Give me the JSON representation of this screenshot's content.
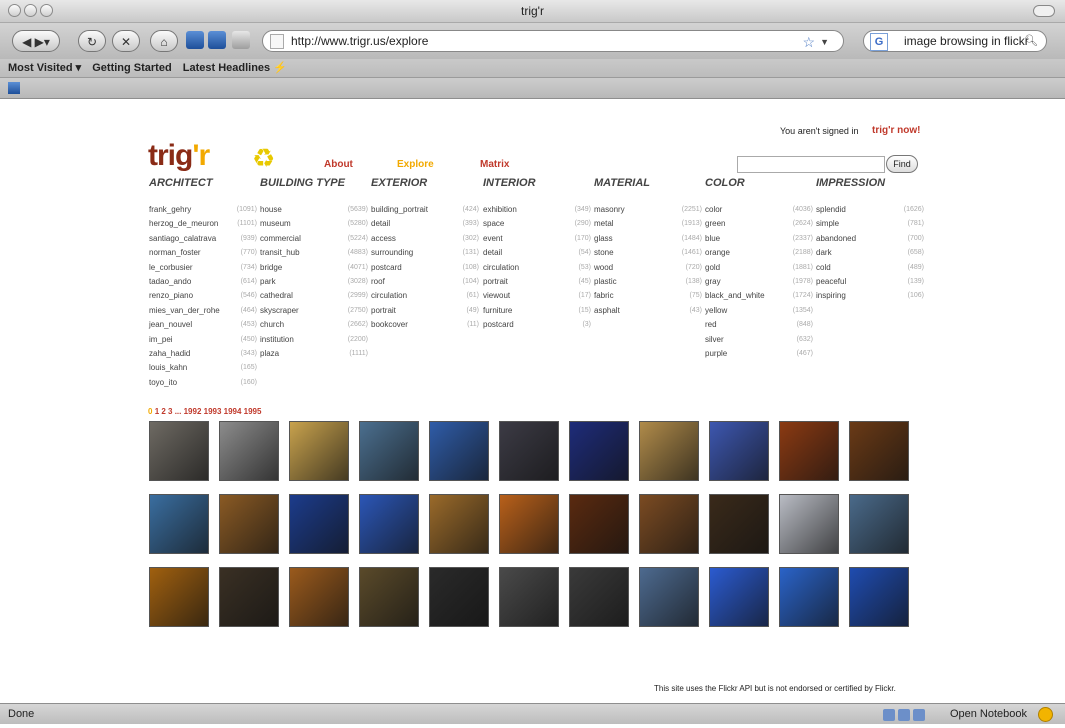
{
  "window": {
    "title": "trig'r"
  },
  "toolbar": {
    "url": "http://www.trigr.us/explore",
    "search_value": "image browsing in flickr",
    "search_engine_glyph": "G"
  },
  "bookmarks": [
    "Most Visited ▾",
    "Getting Started",
    "Latest Headlines ⚡"
  ],
  "statusbar": {
    "left": "Done",
    "right": "Open Notebook"
  },
  "page": {
    "signin_text": "You aren't signed in",
    "trigr_now": "trig'r now!",
    "logo_a": "trig",
    "logo_b": "'r",
    "nav": [
      {
        "label": "About",
        "color": "#c0392b"
      },
      {
        "label": "Explore",
        "color": "#f2a900"
      },
      {
        "label": "Matrix",
        "color": "#c0392b"
      }
    ],
    "find_label": "Find",
    "columns": [
      {
        "title": "ARCHITECT",
        "items": [
          [
            "frank_gehry",
            "(1091)"
          ],
          [
            "herzog_de_meuron",
            "(1101)"
          ],
          [
            "santiago_calatrava",
            "(939)"
          ],
          [
            "norman_foster",
            "(770)"
          ],
          [
            "le_corbusier",
            "(734)"
          ],
          [
            "tadao_ando",
            "(614)"
          ],
          [
            "renzo_piano",
            "(546)"
          ],
          [
            "mies_van_der_rohe",
            "(464)"
          ],
          [
            "jean_nouvel",
            "(453)"
          ],
          [
            "im_pei",
            "(450)"
          ],
          [
            "zaha_hadid",
            "(343)"
          ],
          [
            "louis_kahn",
            "(165)"
          ],
          [
            "toyo_ito",
            "(160)"
          ]
        ]
      },
      {
        "title": "BUILDING TYPE",
        "items": [
          [
            "house",
            "(5639)"
          ],
          [
            "museum",
            "(5280)"
          ],
          [
            "commercial",
            "(5224)"
          ],
          [
            "transit_hub",
            "(4883)"
          ],
          [
            "bridge",
            "(4071)"
          ],
          [
            "park",
            "(3028)"
          ],
          [
            "cathedral",
            "(2999)"
          ],
          [
            "skyscraper",
            "(2750)"
          ],
          [
            "church",
            "(2662)"
          ],
          [
            "institution",
            "(2200)"
          ],
          [
            "plaza",
            "(1111)"
          ]
        ]
      },
      {
        "title": "EXTERIOR",
        "items": [
          [
            "building_portrait",
            "(424)"
          ],
          [
            "detail",
            "(393)"
          ],
          [
            "access",
            "(302)"
          ],
          [
            "surrounding",
            "(131)"
          ],
          [
            "postcard",
            "(108)"
          ],
          [
            "roof",
            "(104)"
          ],
          [
            "circulation",
            "(61)"
          ],
          [
            "portrait",
            "(49)"
          ],
          [
            "bookcover",
            "(11)"
          ]
        ]
      },
      {
        "title": "INTERIOR",
        "items": [
          [
            "exhibition",
            "(349)"
          ],
          [
            "space",
            "(290)"
          ],
          [
            "event",
            "(170)"
          ],
          [
            "detail",
            "(54)"
          ],
          [
            "circulation",
            "(53)"
          ],
          [
            "portrait",
            "(45)"
          ],
          [
            "viewout",
            "(17)"
          ],
          [
            "furniture",
            "(15)"
          ],
          [
            "postcard",
            "(3)"
          ]
        ]
      },
      {
        "title": "MATERIAL",
        "items": [
          [
            "masonry",
            "(2251)"
          ],
          [
            "metal",
            "(1913)"
          ],
          [
            "glass",
            "(1484)"
          ],
          [
            "stone",
            "(1461)"
          ],
          [
            "wood",
            "(720)"
          ],
          [
            "plastic",
            "(138)"
          ],
          [
            "fabric",
            "(75)"
          ],
          [
            "asphalt",
            "(43)"
          ]
        ]
      },
      {
        "title": "COLOR",
        "items": [
          [
            "color",
            "(4036)"
          ],
          [
            "green",
            "(2624)"
          ],
          [
            "blue",
            "(2337)"
          ],
          [
            "orange",
            "(2188)"
          ],
          [
            "gold",
            "(1881)"
          ],
          [
            "gray",
            "(1978)"
          ],
          [
            "black_and_white",
            "(1724)"
          ],
          [
            "yellow",
            "(1354)"
          ],
          [
            "red",
            "(848)"
          ],
          [
            "silver",
            "(632)"
          ],
          [
            "purple",
            "(467)"
          ]
        ]
      },
      {
        "title": "IMPRESSION",
        "items": [
          [
            "splendid",
            "(1626)"
          ],
          [
            "simple",
            "(781)"
          ],
          [
            "abandoned",
            "(700)"
          ],
          [
            "dark",
            "(658)"
          ],
          [
            "cold",
            "(489)"
          ],
          [
            "peaceful",
            "(139)"
          ],
          [
            "inspiring",
            "(106)"
          ]
        ]
      }
    ],
    "pager": {
      "current": "0",
      "rest": "1 2 3 ... 1992 1993 1994 1995"
    },
    "thumb_colors": [
      [
        "#6e6a63",
        "#8c8c8c",
        "#c8a24d",
        "#4b6f8f",
        "#2f5ca8",
        "#3c3b45",
        "#1e2c7a",
        "#b08b4a",
        "#3d57b0",
        "#8b3a12",
        "#6a3a16"
      ],
      [
        "#3a6ea0",
        "#8a5a24",
        "#1c3c8c",
        "#2b56b6",
        "#9a6a2a",
        "#b8601a",
        "#5a2a10",
        "#7b4b22",
        "#3a2a1a",
        "#b9bcc4",
        "#4a6a8a"
      ],
      [
        "#a0600f",
        "#3a3024",
        "#9a5a1c",
        "#5a4a2a",
        "#2a2a2a",
        "#4a4a4a",
        "#3a3a3a",
        "#4d6a8f",
        "#2b5bd0",
        "#2a63c8",
        "#1f4cb0"
      ]
    ],
    "footnote": "This site uses the Flickr API but is not endorsed or certified by Flickr."
  }
}
